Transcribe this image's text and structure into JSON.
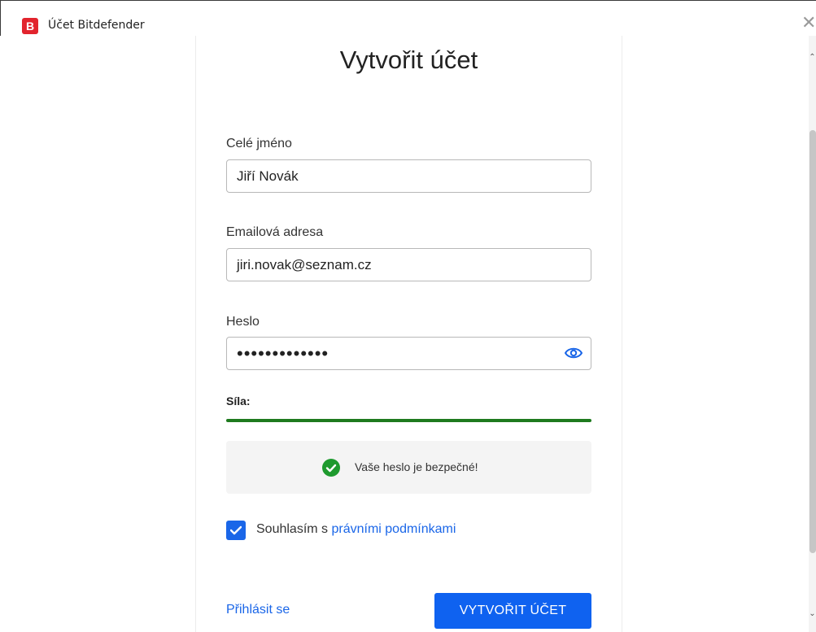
{
  "window": {
    "logo_letter": "B",
    "title": "Účet Bitdefender",
    "close_glyph": "✕"
  },
  "form": {
    "title": "Vytvořit účet",
    "full_name": {
      "label": "Celé jméno",
      "value": "Jiří Novák"
    },
    "email": {
      "label": "Emailová adresa",
      "value": "jiri.novak@seznam.cz"
    },
    "password": {
      "label": "Heslo",
      "value": "•••••••••••••"
    },
    "strength": {
      "label": "Síla:",
      "level": 1.0,
      "color": "#1e7a1e"
    },
    "safe_message": "Vaše heslo je bezpečné!",
    "terms": {
      "checked": true,
      "prefix": "Souhlasím s ",
      "link": "právními podmínkami"
    },
    "login_link": "Přihlásit se",
    "create_button": "VYTVOŘIT ÚČET"
  },
  "icons": {
    "eye": "eye-icon",
    "check": "check-circle-icon",
    "checkbox": "checkmark-icon"
  },
  "colors": {
    "accent": "#0f62f0",
    "link": "#1a66e8",
    "success": "#1e9a2e",
    "brand": "#e2242d"
  }
}
